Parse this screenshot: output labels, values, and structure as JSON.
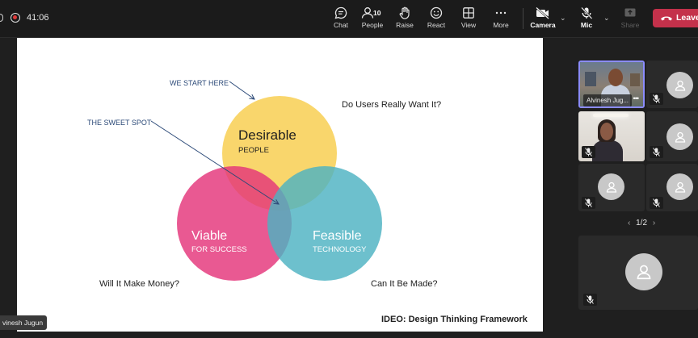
{
  "meeting": {
    "timer": "41:06",
    "toolbar": {
      "chat": "Chat",
      "people": "People",
      "people_count": "10",
      "raise": "Raise",
      "react": "React",
      "view": "View",
      "more": "More",
      "camera": "Camera",
      "mic": "Mic",
      "share": "Share",
      "leave": "Leave"
    }
  },
  "slide": {
    "annotation_start": "WE START HERE",
    "annotation_sweet": "THE SWEET SPOT",
    "desirable_title": "Desirable",
    "desirable_sub": "PEOPLE",
    "viable_title": "Viable",
    "viable_sub": "FOR SUCCESS",
    "feasible_title": "Feasible",
    "feasible_sub": "TECHNOLOGY",
    "question_users": "Do Users Really Want It?",
    "question_money": "Will It Make Money?",
    "question_made": "Can It Be Made?",
    "footer": "IDEO: Design Thinking Framework",
    "colors": {
      "desirable": "#f8cf52",
      "viable": "#e4347a",
      "feasible": "#4db2c2",
      "annotation": "#2c4a78"
    }
  },
  "presenter_tag": "vinesh Jugun",
  "gallery": {
    "tile1_name": "Alvinesh Jug...",
    "tile1_more": "•••",
    "page_indicator": "1/2",
    "prev_arrow": "‹",
    "next_arrow": "›"
  }
}
